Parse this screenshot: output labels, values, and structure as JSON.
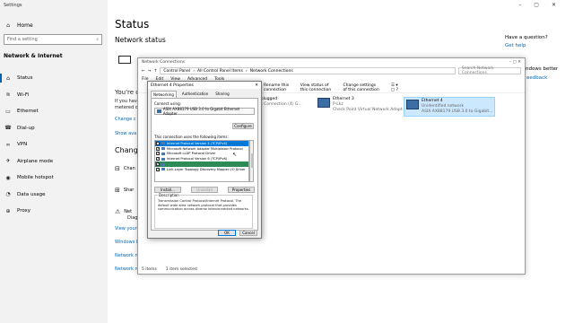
{
  "settings": {
    "app_title": "Settings",
    "home": "Home",
    "search_placeholder": "Find a setting",
    "section": "Network & Internet",
    "nav": [
      {
        "label": "Status",
        "icon": "home-globe-icon",
        "glyph": "⌂"
      },
      {
        "label": "Wi-Fi",
        "icon": "wifi-icon",
        "glyph": "≋"
      },
      {
        "label": "Ethernet",
        "icon": "ethernet-icon",
        "glyph": "▭"
      },
      {
        "label": "Dial-up",
        "icon": "dialup-icon",
        "glyph": "☎"
      },
      {
        "label": "VPN",
        "icon": "vpn-icon",
        "glyph": "∞"
      },
      {
        "label": "Airplane mode",
        "icon": "airplane-icon",
        "glyph": "✈"
      },
      {
        "label": "Mobile hotspot",
        "icon": "hotspot-icon",
        "glyph": "◉"
      },
      {
        "label": "Data usage",
        "icon": "data-usage-icon",
        "glyph": "◔"
      },
      {
        "label": "Proxy",
        "icon": "proxy-icon",
        "glyph": "⊕"
      }
    ],
    "page_title": "Status",
    "network_status": "Network status",
    "youre": "You're c",
    "ifyou": "If you hav",
    "metered": "metered c",
    "change": "Change c",
    "show": "Show ava",
    "change_heading": "Change",
    "opt1": "Chan",
    "opt2": "Shar",
    "opt3": "Net",
    "opt3_sub": "Diag",
    "view": "View your",
    "firewall": "Windows I",
    "reset": "Network re",
    "netreset2": "Network re",
    "have_q": "Have a question?",
    "get_help": "Get help",
    "windows_better": "ndows better",
    "feedback": "eedback"
  },
  "netconn": {
    "title": "Network Connections",
    "path": [
      "Control Panel",
      "All Control Panel Items",
      "Network Connections"
    ],
    "search": "Search Network Connections",
    "menu": [
      "File",
      "Edit",
      "View",
      "Advanced",
      "Tools"
    ],
    "cmds": [
      "Rename this connection",
      "View status of this connection",
      "Change settings of this connection"
    ],
    "adapters": [
      {
        "name": "",
        "status": "able unplugged",
        "desc": "Network Connection (4) G..."
      },
      {
        "name": "Ethernet 3",
        "status": "P-Lkz",
        "desc": "Check Point Virtual Network Adapt..."
      },
      {
        "name": "Ethernet 4",
        "status": "Unidentified network",
        "desc": "ASIX AX88179 USB 3.0 to Gigabit..."
      }
    ],
    "status_count": "5 items",
    "status_sel": "1 item selected"
  },
  "props": {
    "title": "Ethernet 4 Properties",
    "tabs": [
      "Networking",
      "Authentication",
      "Sharing"
    ],
    "connect_using": "Connect using:",
    "adapter": "ASIX AX88179 USB 3.0 to Gigabit Ethernet Adapter",
    "configure": "Configure",
    "items_label": "This connection uses the following items:",
    "items": [
      "Internet Protocol Version 4 (TCP/IPv4)",
      "Microsoft Network Adapter Multiplexor Protocol",
      "Microsoft LLDP Protocol Driver",
      "Internet Protocol Version 6 (TCP/IPv6)",
      "",
      "Link-Layer Topology Discovery Mapper I/O Driver"
    ],
    "install": "Install...",
    "uninstall": "Uninstall",
    "properties": "Properties",
    "description_title": "Description",
    "description": "Transmission Control Protocol/Internet Protocol. The default wide area network protocol that provides communication across diverse interconnected networks.",
    "ok": "OK",
    "cancel": "Cancel",
    "close_glyph": "✕"
  }
}
